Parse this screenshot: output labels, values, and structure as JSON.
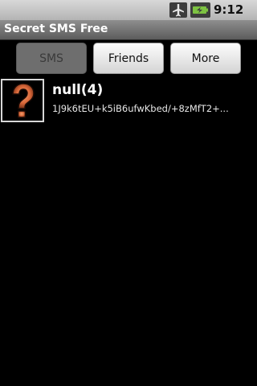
{
  "status_bar": {
    "time": "9:12 PM"
  },
  "app": {
    "title": "Secret SMS Free"
  },
  "tabs": [
    {
      "label": "SMS",
      "active": true
    },
    {
      "label": "Friends",
      "active": false
    },
    {
      "label": "More",
      "active": false
    }
  ],
  "messages": [
    {
      "contact": "null(4)",
      "preview": "1J9k6tEU+k5iB6ufwKbed/+8zMfT2+...",
      "avatar_icon": "question-mark-icon"
    }
  ],
  "colors": {
    "accent_orange": "#d9683a",
    "background": "#000000"
  }
}
